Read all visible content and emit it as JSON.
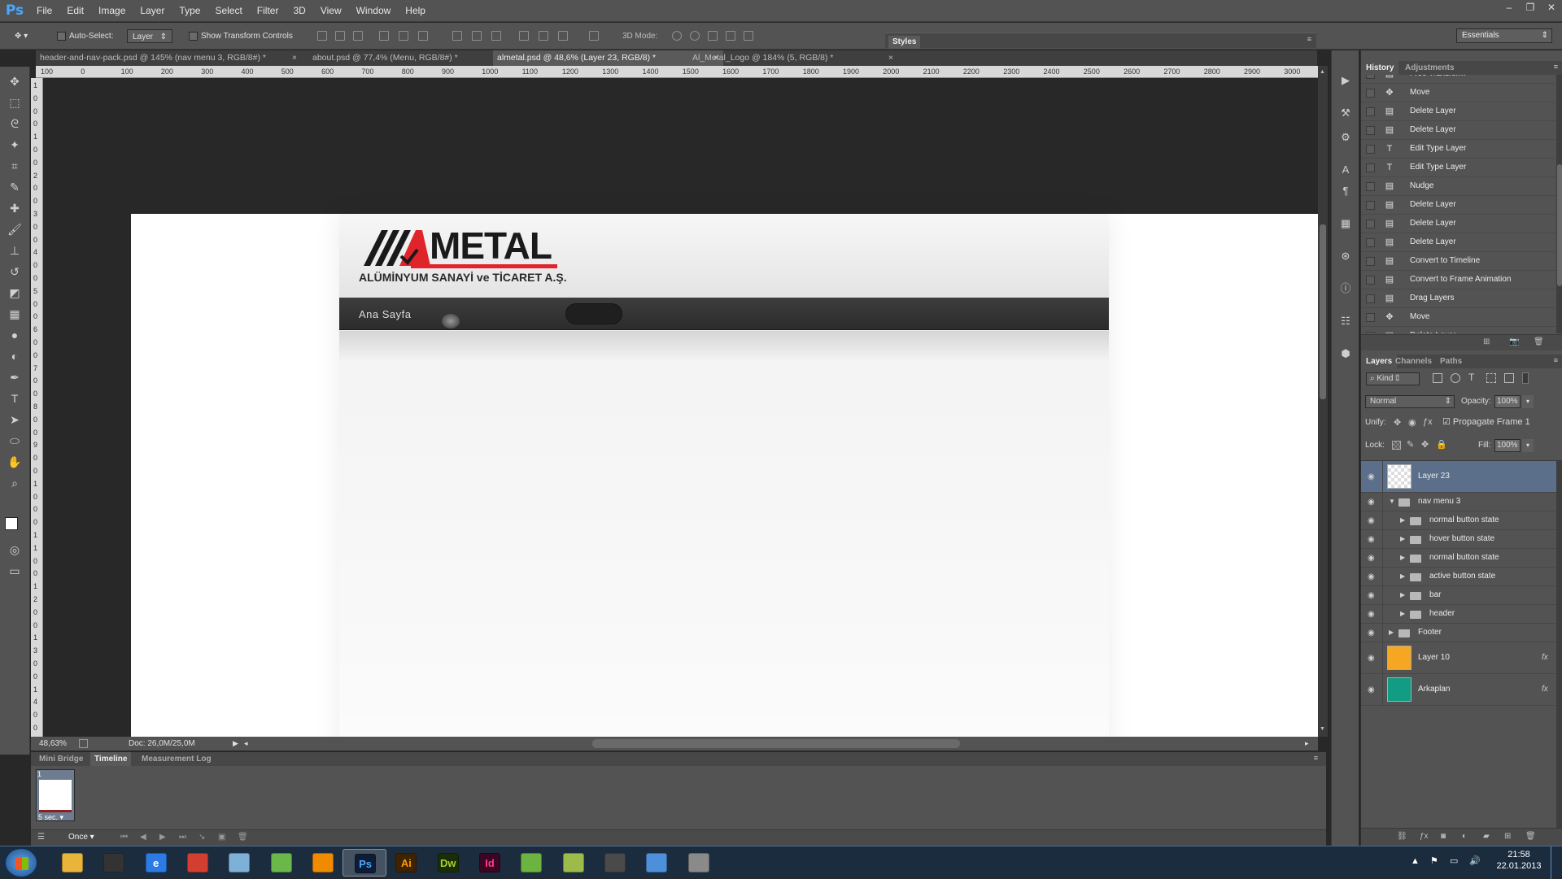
{
  "app": {
    "logo": "Ps",
    "accent": "#49a8ff"
  },
  "menu": [
    "File",
    "Edit",
    "Image",
    "Layer",
    "Type",
    "Select",
    "Filter",
    "3D",
    "View",
    "Window",
    "Help"
  ],
  "window_controls": [
    "–",
    "❐",
    "✕"
  ],
  "options": {
    "auto_select_label": "Auto-Select:",
    "auto_select_value": "Layer",
    "transform_label": "Show Transform Controls",
    "mode3d_label": "3D Mode:",
    "styles_tab": "Styles",
    "workspace": "Essentials"
  },
  "tabs": [
    {
      "label": "header-and-nav-pack.psd @ 145% (nav menu 3, RGB/8#) *"
    },
    {
      "label": "about.psd @ 77,4% (Menu, RGB/8#) *"
    },
    {
      "label": "almetal.psd @ 48,6% (Layer 23, RGB/8) *"
    },
    {
      "label": "Al_Metal_Logo @ 184% (5, RGB/8) *"
    }
  ],
  "ruler_h": [
    "100",
    "0",
    "100",
    "200",
    "300",
    "400",
    "500",
    "600",
    "700",
    "800",
    "900",
    "1000",
    "1100",
    "1200",
    "1300",
    "1400",
    "1500",
    "1600",
    "1700",
    "1800",
    "1900",
    "2000",
    "2100",
    "2200",
    "2300",
    "2400",
    "2500",
    "2600",
    "2700",
    "2800",
    "2900",
    "3000"
  ],
  "ruler_v": [
    "1",
    "0",
    "0",
    "0",
    "1",
    "0",
    "0",
    "2",
    "0",
    "0",
    "3",
    "0",
    "0",
    "4",
    "0",
    "0",
    "5",
    "0",
    "0",
    "6",
    "0",
    "0",
    "7",
    "0",
    "0",
    "8",
    "0",
    "0",
    "9",
    "0",
    "0",
    "1",
    "0",
    "0",
    "0",
    "1",
    "1",
    "0",
    "0",
    "1",
    "2",
    "0",
    "0",
    "1",
    "3",
    "0",
    "0",
    "1",
    "4",
    "0",
    "0"
  ],
  "site": {
    "logo_text": "METAL",
    "logo_sub": "ALÜMİNYUM SANAYİ ve TİCARET A.Ş.",
    "nav_item": "Ana Sayfa"
  },
  "status": {
    "zoom": "48,63%",
    "doc": "Doc: 26,0M/25,0M"
  },
  "bottom_tabs": [
    "Mini Bridge",
    "Timeline",
    "Measurement Log"
  ],
  "timeline": {
    "frame_number": "1",
    "frame_delay": "5 sec.",
    "loop": "Once"
  },
  "history": {
    "tab_history": "History",
    "tab_adjustments": "Adjustments",
    "items": [
      {
        "label": "Free Transform",
        "icon": "doc-icon"
      },
      {
        "label": "Move",
        "icon": "move-icon"
      },
      {
        "label": "Delete Layer",
        "icon": "doc-icon"
      },
      {
        "label": "Delete Layer",
        "icon": "doc-icon"
      },
      {
        "label": "Edit Type Layer",
        "icon": "type-icon"
      },
      {
        "label": "Edit Type Layer",
        "icon": "type-icon"
      },
      {
        "label": "Nudge",
        "icon": "doc-icon"
      },
      {
        "label": "Delete Layer",
        "icon": "doc-icon"
      },
      {
        "label": "Delete Layer",
        "icon": "doc-icon"
      },
      {
        "label": "Delete Layer",
        "icon": "doc-icon"
      },
      {
        "label": "Convert to Timeline",
        "icon": "doc-icon"
      },
      {
        "label": "Convert to Frame Animation",
        "icon": "doc-icon"
      },
      {
        "label": "Drag Layers",
        "icon": "doc-icon"
      },
      {
        "label": "Move",
        "icon": "move-icon"
      },
      {
        "label": "Delete Layer",
        "icon": "doc-icon"
      }
    ]
  },
  "layers": {
    "tabs": [
      "Layers",
      "Channels",
      "Paths"
    ],
    "kind": "Kind",
    "blend": "Normal",
    "opacity_label": "Opacity:",
    "opacity": "100%",
    "unify_label": "Unify:",
    "propagate": "Propagate Frame 1",
    "lock_label": "Lock:",
    "fill_label": "Fill:",
    "fill": "100%",
    "fx": "fx",
    "items": [
      {
        "name": "Layer 23",
        "type": "layer",
        "thumb": "transparent",
        "selected": true,
        "indent": 0
      },
      {
        "name": "nav menu 3",
        "type": "group-open",
        "indent": 0
      },
      {
        "name": "normal button state",
        "type": "group",
        "indent": 1
      },
      {
        "name": "hover button state",
        "type": "group",
        "indent": 1
      },
      {
        "name": "normal button state",
        "type": "group",
        "indent": 1
      },
      {
        "name": "active button state",
        "type": "group",
        "indent": 1
      },
      {
        "name": "bar",
        "type": "group",
        "indent": 1
      },
      {
        "name": "header",
        "type": "group",
        "indent": 1
      },
      {
        "name": "Footer",
        "type": "group",
        "indent": 0
      },
      {
        "name": "Layer 10",
        "type": "layer",
        "thumb": "#f5a623",
        "fx": true,
        "indent": 0
      },
      {
        "name": "Arkaplan",
        "type": "layer",
        "thumb": "#119c83",
        "fx": true,
        "indent": 0
      }
    ]
  },
  "clock": {
    "time": "21:58",
    "date": "22.01.2013"
  },
  "taskbar_apps": [
    {
      "name": "explorer",
      "label": "",
      "color": "#e9b43a"
    },
    {
      "name": "rss",
      "label": "",
      "color": "#333"
    },
    {
      "name": "internet-explorer",
      "label": "e",
      "color": "#2c7be5"
    },
    {
      "name": "chrome",
      "label": "",
      "color": "#d23f31"
    },
    {
      "name": "notepad",
      "label": "",
      "color": "#7fb0d8"
    },
    {
      "name": "messenger",
      "label": "",
      "color": "#6bb84a"
    },
    {
      "name": "vlc",
      "label": "",
      "color": "#f08a00"
    },
    {
      "name": "photoshop",
      "label": "Ps",
      "color": "#0e1d35"
    },
    {
      "name": "illustrator",
      "label": "Ai",
      "color": "#3d2302"
    },
    {
      "name": "dreamweaver",
      "label": "Dw",
      "color": "#1b2d06"
    },
    {
      "name": "indesign",
      "label": "Id",
      "color": "#3a0623"
    },
    {
      "name": "evernote",
      "label": "",
      "color": "#6db33f"
    },
    {
      "name": "filezilla",
      "label": "",
      "color": "#9dbb4a"
    },
    {
      "name": "terminal",
      "label": "",
      "color": "#4a4a4a"
    },
    {
      "name": "outlook",
      "label": "",
      "color": "#4d8fd9"
    },
    {
      "name": "calculator",
      "label": "",
      "color": "#8a8a8a"
    }
  ]
}
